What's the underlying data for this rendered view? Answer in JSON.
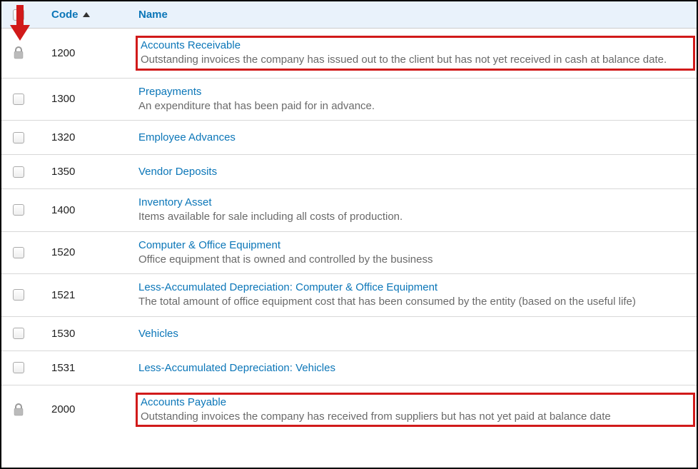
{
  "headers": {
    "code": "Code",
    "name": "Name"
  },
  "rows": [
    {
      "code": "1200",
      "name": "Accounts Receivable",
      "desc": "Outstanding invoices the company has issued out to the client but has not yet received in cash at balance date.",
      "locked": true,
      "highlight": true
    },
    {
      "code": "1300",
      "name": "Prepayments",
      "desc": "An expenditure that has been paid for in advance.",
      "locked": false,
      "highlight": false
    },
    {
      "code": "1320",
      "name": "Employee Advances",
      "desc": "",
      "locked": false,
      "highlight": false
    },
    {
      "code": "1350",
      "name": "Vendor Deposits",
      "desc": "",
      "locked": false,
      "highlight": false
    },
    {
      "code": "1400",
      "name": "Inventory Asset",
      "desc": "Items available for sale including all costs of production.",
      "locked": false,
      "highlight": false
    },
    {
      "code": "1520",
      "name": "Computer & Office Equipment",
      "desc": "Office equipment that is owned and controlled by the business",
      "locked": false,
      "highlight": false
    },
    {
      "code": "1521",
      "name": "Less-Accumulated Depreciation: Computer & Office Equipment",
      "desc": "The total amount of office equipment cost that has been consumed by the entity (based on the useful life)",
      "locked": false,
      "highlight": false
    },
    {
      "code": "1530",
      "name": "Vehicles",
      "desc": "",
      "locked": false,
      "highlight": false
    },
    {
      "code": "1531",
      "name": "Less-Accumulated Depreciation: Vehicles",
      "desc": "",
      "locked": false,
      "highlight": false
    },
    {
      "code": "2000",
      "name": "Accounts Payable",
      "desc": "Outstanding invoices the company has received from suppliers but has not yet paid at balance date",
      "locked": true,
      "highlight": true
    }
  ]
}
